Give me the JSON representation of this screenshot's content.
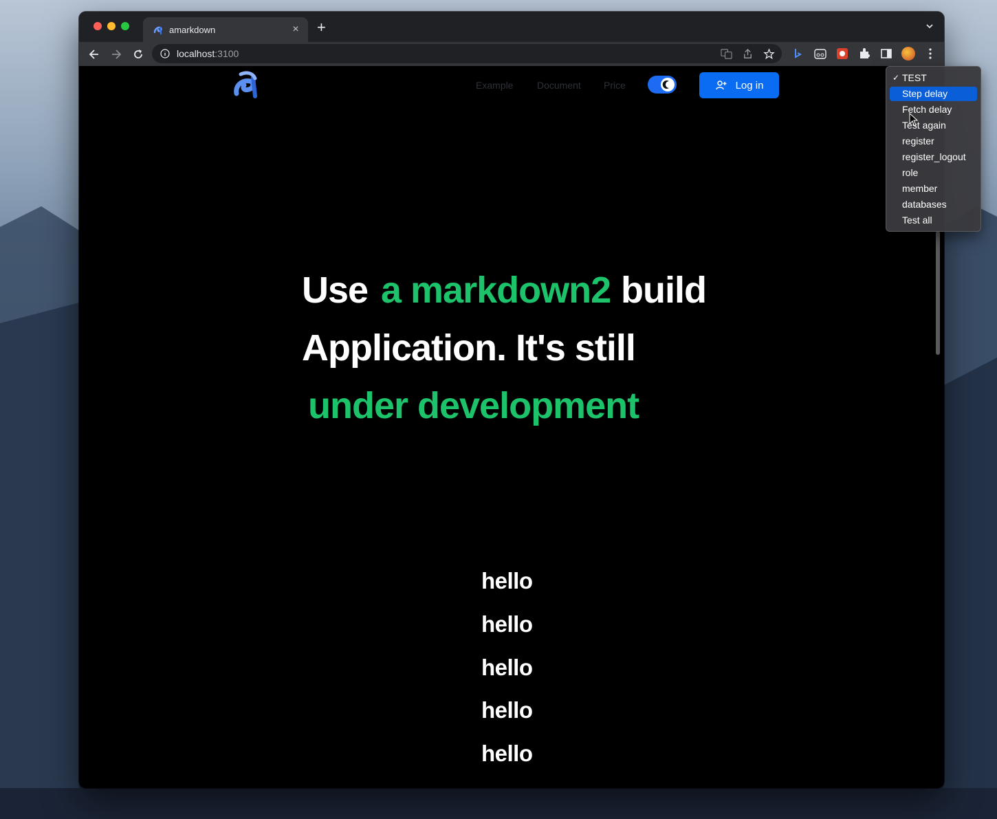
{
  "browser": {
    "tab_title": "amarkdown",
    "tab_close": "×",
    "new_tab": "+",
    "url_host": "localhost",
    "url_port": ":3100"
  },
  "site": {
    "nav": [
      "Example",
      "Document",
      "Price"
    ],
    "theme_toggle_state": "dark",
    "login_label": "Log in"
  },
  "hero": {
    "line1_a": "Use",
    "line1_b": "a markdown2",
    "line1_c": "build",
    "line2": "Application. It's still",
    "line3": "under development"
  },
  "hellos": [
    "hello",
    "hello",
    "hello",
    "hello",
    "hello"
  ],
  "menu": {
    "items": [
      {
        "label": "TEST",
        "checked": true
      },
      {
        "label": "Step delay",
        "highlighted": true
      },
      {
        "label": "Fetch delay"
      },
      {
        "label": "Test again"
      },
      {
        "label": "register"
      },
      {
        "label": "register_logout"
      },
      {
        "label": "role"
      },
      {
        "label": "member"
      },
      {
        "label": "databases"
      },
      {
        "label": "Test all"
      }
    ],
    "check_mark": "✓"
  },
  "colors": {
    "accent_green": "#1dc36a",
    "primary_blue": "#0a6cf2",
    "menu_highlight": "#0a5fd8"
  }
}
